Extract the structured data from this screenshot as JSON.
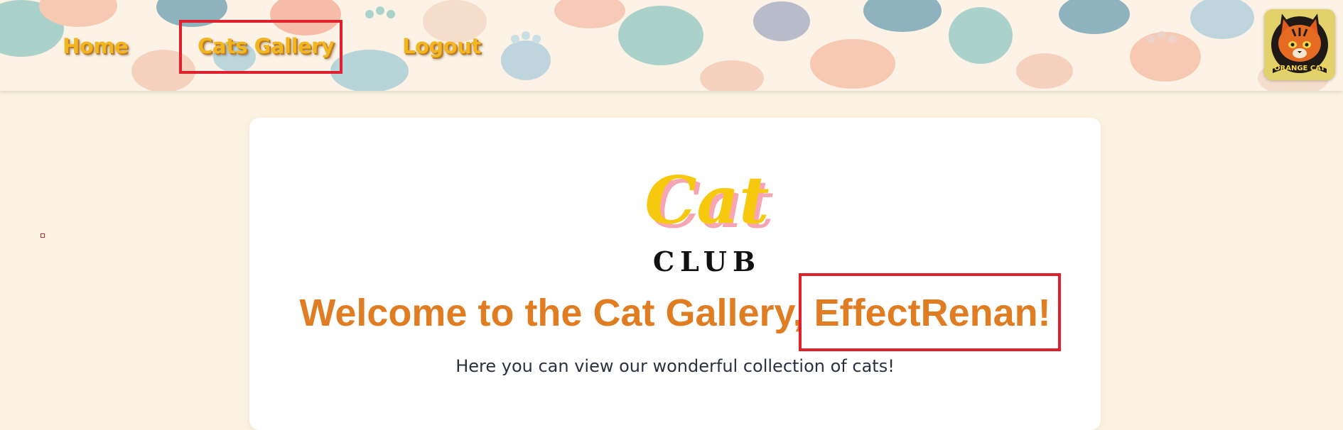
{
  "nav": {
    "home": "Home",
    "gallery": "Cats Gallery",
    "logout": "Logout"
  },
  "brand": {
    "icon": "orange-cat-badge-icon",
    "badge_text": "ORANGE CAT"
  },
  "logo": {
    "word_top": "Cat",
    "word_bottom": "CLUB"
  },
  "welcome": {
    "title": "Welcome to the Cat Gallery, EffectRenan!",
    "subtitle": "Here you can view our wonderful collection of cats!"
  },
  "colors": {
    "background": "#fcf3e3",
    "nav_text": "#f2b623",
    "title": "#e07d22",
    "highlight": "#e0202c",
    "logo_yellow": "#f6c90e",
    "logo_pink": "#f6a5b3"
  }
}
